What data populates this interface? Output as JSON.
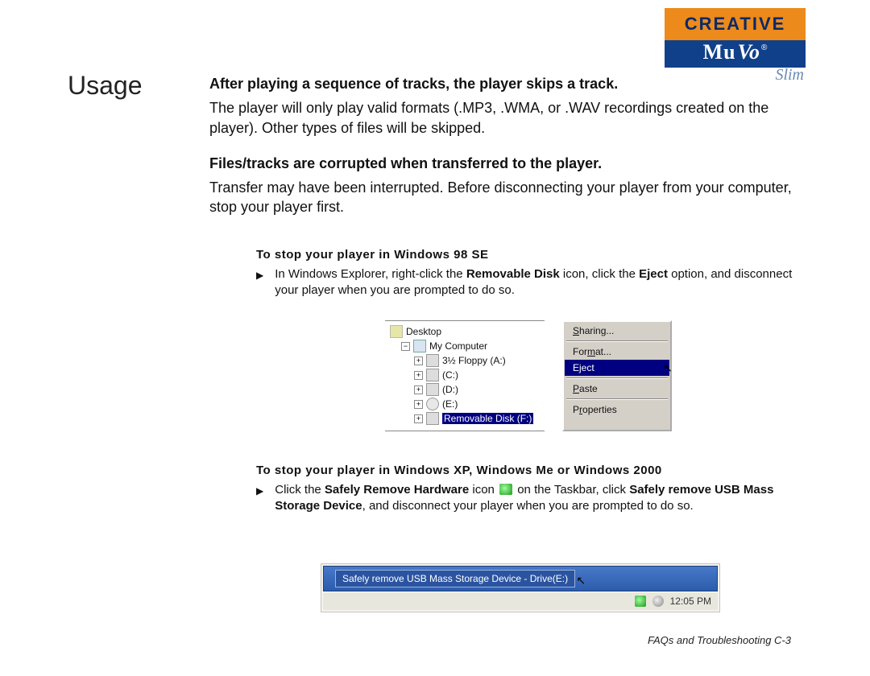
{
  "logo": {
    "brand": "CREATIVE",
    "product1": "Mu",
    "product2": "Vo",
    "reg": "®",
    "variant": "Slim"
  },
  "section_title": "Usage",
  "faq": [
    {
      "q": "After playing a sequence of tracks, the player skips a track.",
      "a": "The player will only play valid formats (.MP3, .WMA, or .WAV recordings created on the player). Other types of files will be skipped."
    },
    {
      "q": "Files/tracks are corrupted when transferred to the player.",
      "a": "Transfer may have been interrupted. Before disconnecting your player from your computer, stop your player first."
    }
  ],
  "steps": {
    "win98": {
      "title": "To stop your player in Windows 98 SE",
      "text_parts": [
        "In Windows Explorer, right-click the ",
        "Removable Disk",
        " icon, click the ",
        "Eject",
        " option, and disconnect your player when you are prompted to do so."
      ]
    },
    "winxp": {
      "title": "To stop your player in Windows XP, Windows Me or Windows 2000",
      "text_parts": [
        "Click the ",
        "Safely Remove Hardware",
        " icon ",
        " on the Taskbar, click ",
        "Safely remove USB Mass Storage Device",
        ", and disconnect your player when you are prompted to do so."
      ]
    }
  },
  "explorer_tree": {
    "root": "Desktop",
    "computer": "My Computer",
    "drives": [
      "3½ Floppy (A:)",
      "(C:)",
      "(D:)",
      "(E:)",
      "Removable Disk (F:)"
    ]
  },
  "context_menu": {
    "items": [
      "Sharing...",
      "Format...",
      "Eject",
      "Paste",
      "Properties"
    ],
    "highlighted": "Eject"
  },
  "xp_taskbar": {
    "tooltip": "Safely remove USB Mass Storage Device - Drive(E:)",
    "clock": "12:05 PM"
  },
  "footer": "FAQs and Troubleshooting C-3"
}
